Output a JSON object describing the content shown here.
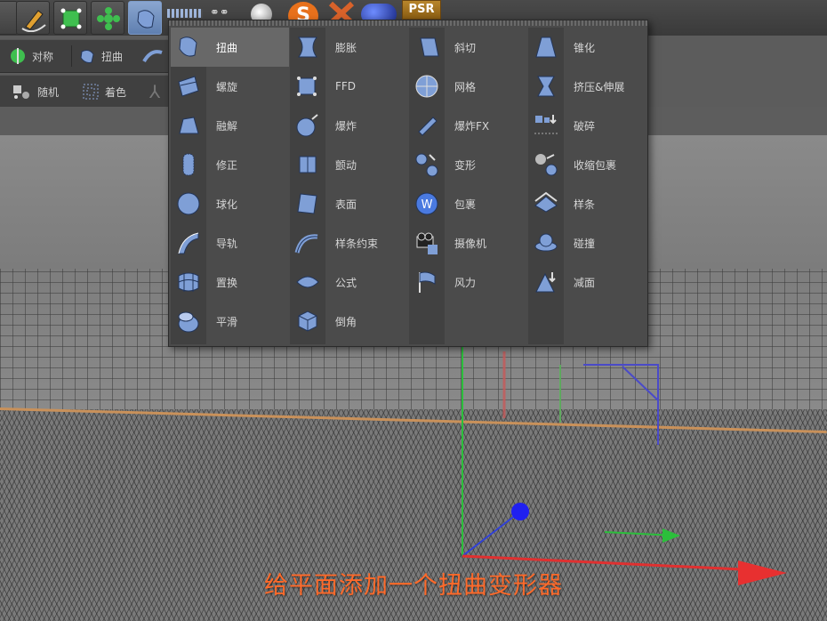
{
  "toolbar": {
    "psr_label": "PSR",
    "row1": {
      "symmetry_label": "对称",
      "twist_label": "扭曲"
    },
    "row2": {
      "random_label": "随机",
      "shader_label": "着色"
    }
  },
  "menu": {
    "columns": [
      [
        {
          "label": "扭曲",
          "icon": "twist-icon",
          "selected": true
        },
        {
          "label": "螺旋",
          "icon": "spiral-icon"
        },
        {
          "label": "融解",
          "icon": "melt-icon"
        },
        {
          "label": "修正",
          "icon": "correction-icon"
        },
        {
          "label": "球化",
          "icon": "spherify-icon"
        },
        {
          "label": "导轨",
          "icon": "rail-icon"
        },
        {
          "label": "置换",
          "icon": "displacer-icon"
        },
        {
          "label": "平滑",
          "icon": "smoothing-icon"
        }
      ],
      [
        {
          "label": "膨胀",
          "icon": "bulge-icon"
        },
        {
          "label": "FFD",
          "icon": "ffd-icon"
        },
        {
          "label": "爆炸",
          "icon": "explosion-icon"
        },
        {
          "label": "颤动",
          "icon": "jiggle-icon"
        },
        {
          "label": "表面",
          "icon": "surface-icon"
        },
        {
          "label": "样条约束",
          "icon": "spline-wrap-icon"
        },
        {
          "label": "公式",
          "icon": "formula-icon"
        },
        {
          "label": "倒角",
          "icon": "bevel-icon"
        }
      ],
      [
        {
          "label": "斜切",
          "icon": "shear-icon"
        },
        {
          "label": "网格",
          "icon": "mesh-icon"
        },
        {
          "label": "爆炸FX",
          "icon": "explosion-fx-icon"
        },
        {
          "label": "变形",
          "icon": "morph-icon"
        },
        {
          "label": "包裹",
          "icon": "wrap-icon"
        },
        {
          "label": "摄像机",
          "icon": "camera-icon"
        },
        {
          "label": "风力",
          "icon": "wind-icon"
        }
      ],
      [
        {
          "label": "锥化",
          "icon": "taper-icon"
        },
        {
          "label": "挤压&伸展",
          "icon": "squash-stretch-icon"
        },
        {
          "label": "破碎",
          "icon": "shatter-icon"
        },
        {
          "label": "收缩包裹",
          "icon": "shrink-wrap-icon"
        },
        {
          "label": "样条",
          "icon": "spline-icon"
        },
        {
          "label": "碰撞",
          "icon": "collision-icon"
        },
        {
          "label": "减面",
          "icon": "polygon-reduction-icon"
        }
      ]
    ]
  },
  "caption": "给平面添加一个扭曲变形器",
  "colors": {
    "accent": "#ff6a2a",
    "selected": "#686868",
    "icon_blue": "#7f9fd6"
  }
}
